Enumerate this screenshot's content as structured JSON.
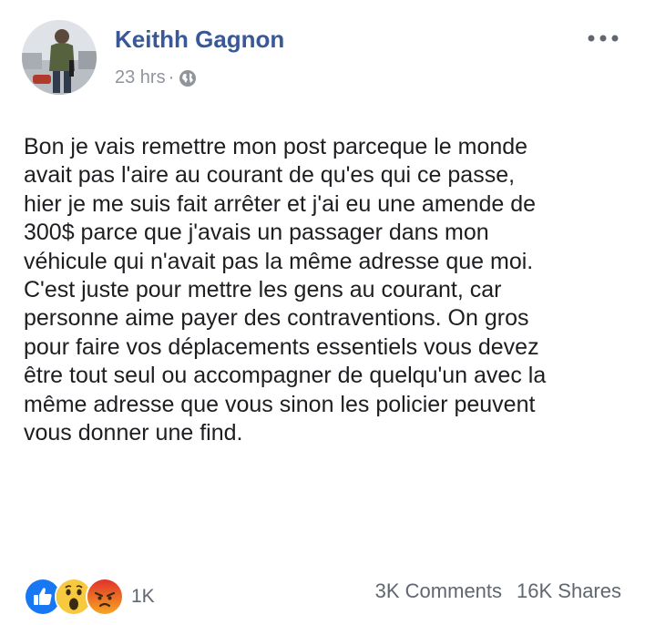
{
  "post": {
    "author": "Keithh Gagnon",
    "timestamp": "23 hrs",
    "separator": "·",
    "privacy_icon": "globe-icon",
    "more_icon": "more-options-icon",
    "lines": [
      "Bon je vais remettre mon post parceque le monde",
      "avait pas l'aire au courant de qu'es qui ce passe,",
      "hier je me suis fait arrêter et j'ai eu une amende de",
      "300$ parce que j'avais un passager dans mon",
      "véhicule qui n'avait pas la même adresse que moi.",
      "C'est juste pour mettre les gens au courant, car",
      "personne aime payer des contraventions. On gros",
      "pour faire vos déplacements essentiels vous devez",
      "être tout seul ou accompagner de quelqu'un avec la",
      "même adresse que vous sinon les policier peuvent",
      "vous donner une find."
    ]
  },
  "footer": {
    "reactions": [
      "like-reaction-icon",
      "wow-reaction-icon",
      "angry-reaction-icon"
    ],
    "reaction_count": "1K",
    "comments": "3K Comments",
    "shares": "16K Shares"
  },
  "colors": {
    "link": "#385898",
    "like": "#1877f2",
    "reaction_yellow": "#f7c93e",
    "reaction_angry": "#e9710f",
    "meta_gray": "#90949c"
  }
}
